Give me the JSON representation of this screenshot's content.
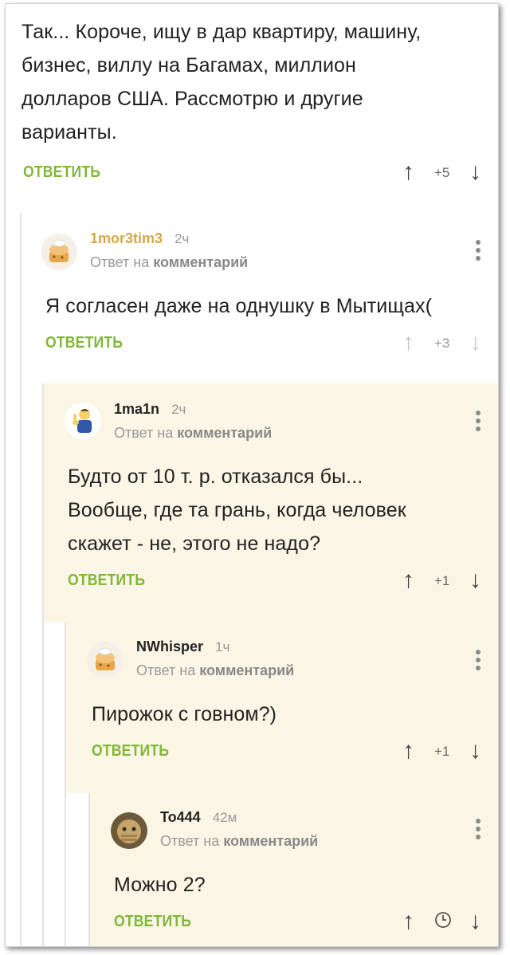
{
  "root": {
    "text_lines": [
      "Так... Короче, ищу в дар квартиру, машину,",
      "бизнес, виллу на Багамах, миллион",
      "долларов США. Рассмотрю и другие",
      "варианты."
    ],
    "reply_label": "ОТВЕТИТЬ",
    "score": "+5"
  },
  "c1": {
    "username": "1mor3tim3",
    "time": "2ч",
    "reply_prefix": "Ответ на",
    "reply_target": "комментарий",
    "text": "Я согласен даже на однушку в Мытищах(",
    "reply_label": "ОТВЕТИТЬ",
    "score": "+3",
    "username_color": "#d4a84a"
  },
  "c2": {
    "username": "1ma1n",
    "time": "2ч",
    "reply_prefix": "Ответ на",
    "reply_target": "комментарий",
    "text_lines": [
      "Будто от 10 т. р. отказался бы...",
      "Вообще, где та грань, когда человек",
      "скажет - не, этого не надо?"
    ],
    "reply_label": "ОТВЕТИТЬ",
    "score": "+1"
  },
  "c3": {
    "username": "NWhisper",
    "time": "1ч",
    "reply_prefix": "Ответ на",
    "reply_target": "комментарий",
    "text": "Пирожок с говном?)",
    "reply_label": "ОТВЕТИТЬ",
    "score": "+1"
  },
  "c4": {
    "username": "To444",
    "time": "42м",
    "reply_prefix": "Ответ на",
    "reply_target": "комментарий",
    "text": "Можно 2?",
    "reply_label": "ОТВЕТИТЬ"
  },
  "icons": {
    "upvote": "↑",
    "downvote": "↓",
    "clock": "clock-icon",
    "more": "more-vertical-icon"
  },
  "colors": {
    "accent_green": "#7fb736",
    "highlight_bg": "#fbf5e6",
    "thread_line": "#e3e3e3"
  }
}
